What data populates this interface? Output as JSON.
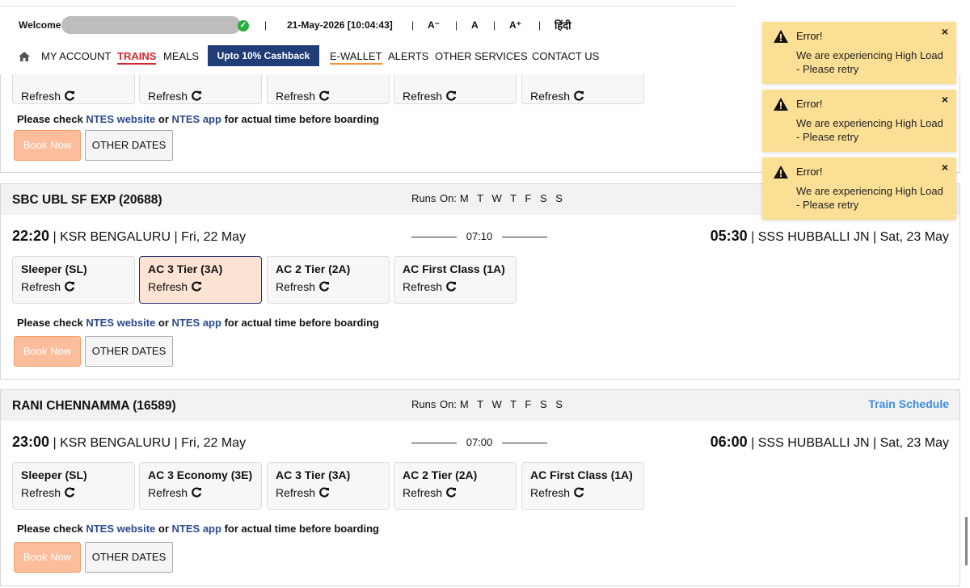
{
  "header": {
    "welcome": "Welcome",
    "datetime": "21-May-2026 [10:04:43]",
    "sep": "|",
    "font_small": "A⁻",
    "font_normal": "A",
    "font_large": "A⁺",
    "language": "हिंदी"
  },
  "nav": {
    "my_account": "MY ACCOUNT",
    "trains": "TRAINS",
    "meals": "MEALS",
    "cashback": "Upto 10% Cashback",
    "ewallet": "E-WALLET",
    "alerts": "ALERTS",
    "other_services": "OTHER SERVICES",
    "contact_us": "CONTACT US"
  },
  "common": {
    "refresh": "Refresh",
    "ntes_prefix": "Please check",
    "ntes_website": "NTES website",
    "ntes_or": "or",
    "ntes_app": "NTES app",
    "ntes_suffix": "for actual time before boarding",
    "book_now": "Book Now",
    "other_dates": "OTHER DATES",
    "runs_on": "Runs On:",
    "runs_days": "M T W T F S S",
    "train_schedule": "Train Schedule"
  },
  "trains": [
    {
      "name": "SBC UBL SF EXP (20688)",
      "dep_time": "22:20",
      "dep_info": "KSR BENGALURU | Fri, 22 May",
      "duration": "07:10",
      "arr_time": "05:30",
      "arr_info": "SSS HUBBALLI JN | Sat, 23 May",
      "classes": [
        "Sleeper (SL)",
        "AC 3 Tier (3A)",
        "AC 2 Tier (2A)",
        "AC First Class (1A)"
      ],
      "selected_class": "AC 3 Tier (3A)"
    },
    {
      "name": "RANI CHENNAMMA (16589)",
      "dep_time": "23:00",
      "dep_info": "KSR BENGALURU | Fri, 22 May",
      "duration": "07:00",
      "arr_time": "06:00",
      "arr_info": "SSS HUBBALLI JN | Sat, 23 May",
      "classes": [
        "Sleeper (SL)",
        "AC 3 Economy (3E)",
        "AC 3 Tier (3A)",
        "AC 2 Tier (2A)",
        "AC First Class (1A)"
      ]
    }
  ],
  "toasts": [
    {
      "title": "Error!",
      "message": "We are experiencing High Load - Please retry",
      "close": "×"
    },
    {
      "title": "Error!",
      "message": "We are experiencing High Load - Please retry",
      "close": "×"
    },
    {
      "title": "Error!",
      "message": "We are experiencing High Load - Please retry",
      "close": "×"
    }
  ],
  "colors": {
    "brand_navy": "#213d77",
    "trains_red": "#d3272d",
    "toast_bg": "#fbdf94",
    "book_now_bg": "#fbbd9b"
  }
}
